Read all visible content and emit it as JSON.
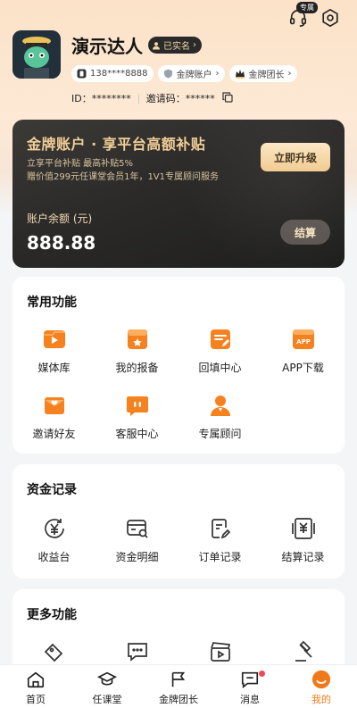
{
  "header": {
    "exclusive_badge": "专属",
    "user_name": "演示达人",
    "verified_label": "已实名",
    "phone": "138****8888",
    "account_tag": "金牌账户",
    "leader_tag": "金牌团长",
    "id_label": "ID：",
    "id_value": "********",
    "invite_label": "邀请码：",
    "invite_value": "******"
  },
  "vip": {
    "title": "金牌账户 · 享平台高额补贴",
    "subtitle_1": "立享平台补贴 最高补贴5%",
    "subtitle_2": "赠价值299元任课堂会员1年，1V1专属顾问服务",
    "upgrade_label": "立即升级",
    "balance_label": "账户余额 (元)",
    "balance_value": "888.88",
    "settle_label": "结算"
  },
  "common": {
    "title": "常用功能",
    "items": [
      {
        "label": "媒体库",
        "icon": "media-library-icon"
      },
      {
        "label": "我的报备",
        "icon": "report-icon"
      },
      {
        "label": "回填中心",
        "icon": "backfill-icon"
      },
      {
        "label": "APP下载",
        "icon": "app-download-icon"
      },
      {
        "label": "邀请好友",
        "icon": "invite-friends-icon"
      },
      {
        "label": "客服中心",
        "icon": "customer-service-icon"
      },
      {
        "label": "专属顾问",
        "icon": "advisor-icon"
      }
    ]
  },
  "funds": {
    "title": "资金记录",
    "items": [
      {
        "label": "收益台",
        "icon": "earnings-icon"
      },
      {
        "label": "资金明细",
        "icon": "fund-details-icon"
      },
      {
        "label": "订单记录",
        "icon": "order-record-icon"
      },
      {
        "label": "结算记录",
        "icon": "settlement-record-icon"
      }
    ]
  },
  "more": {
    "title": "更多功能"
  },
  "tabbar": {
    "items": [
      {
        "label": "首页"
      },
      {
        "label": "任课堂"
      },
      {
        "label": "金牌团长"
      },
      {
        "label": "消息"
      },
      {
        "label": "我的"
      }
    ]
  },
  "colors": {
    "accent": "#f07a1b",
    "gold": "#f3cf98"
  }
}
